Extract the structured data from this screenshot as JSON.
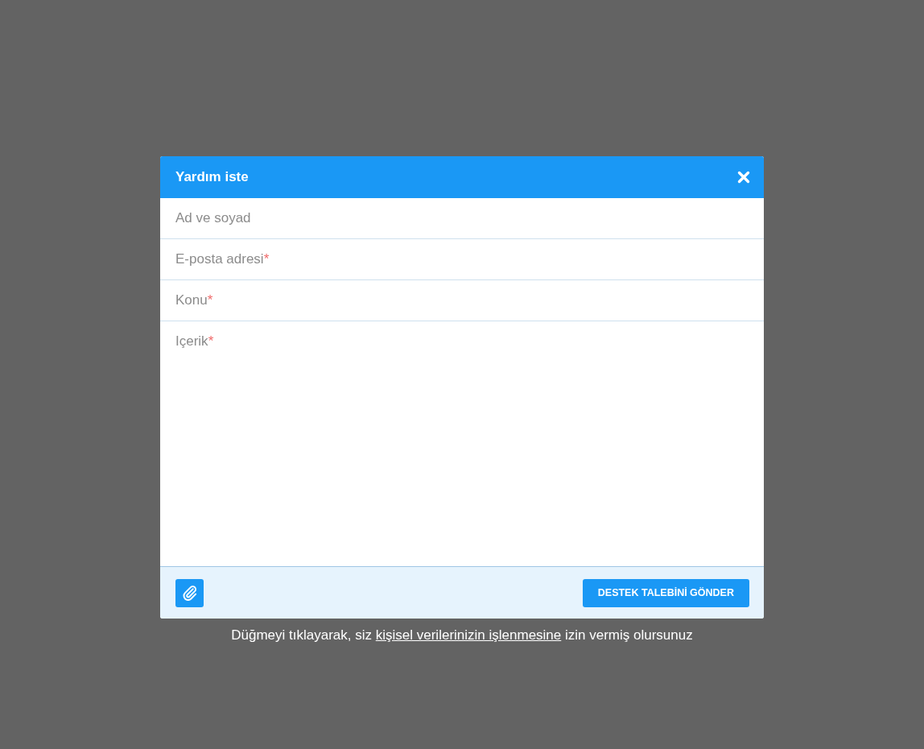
{
  "dialog": {
    "title": "Yardım iste",
    "fields": [
      {
        "kind": "line",
        "placeholder": "Ad ve soyad"
      },
      {
        "kind": "line",
        "placeholder": "E-posta adresi",
        "required_mark": "*"
      },
      {
        "kind": "line",
        "placeholder": "Konu",
        "required_mark": "*"
      },
      {
        "kind": "area",
        "placeholder": "Içerik",
        "required_mark": "*"
      }
    ],
    "submit_button": "DESTEK TALEBİNİ GÖNDER"
  },
  "consent": {
    "before": "Düğmeyi tıklayarak, siz ",
    "link": "kişisel verilerinizin işlenmesine",
    "after": " izin vermiş olursunuz"
  }
}
